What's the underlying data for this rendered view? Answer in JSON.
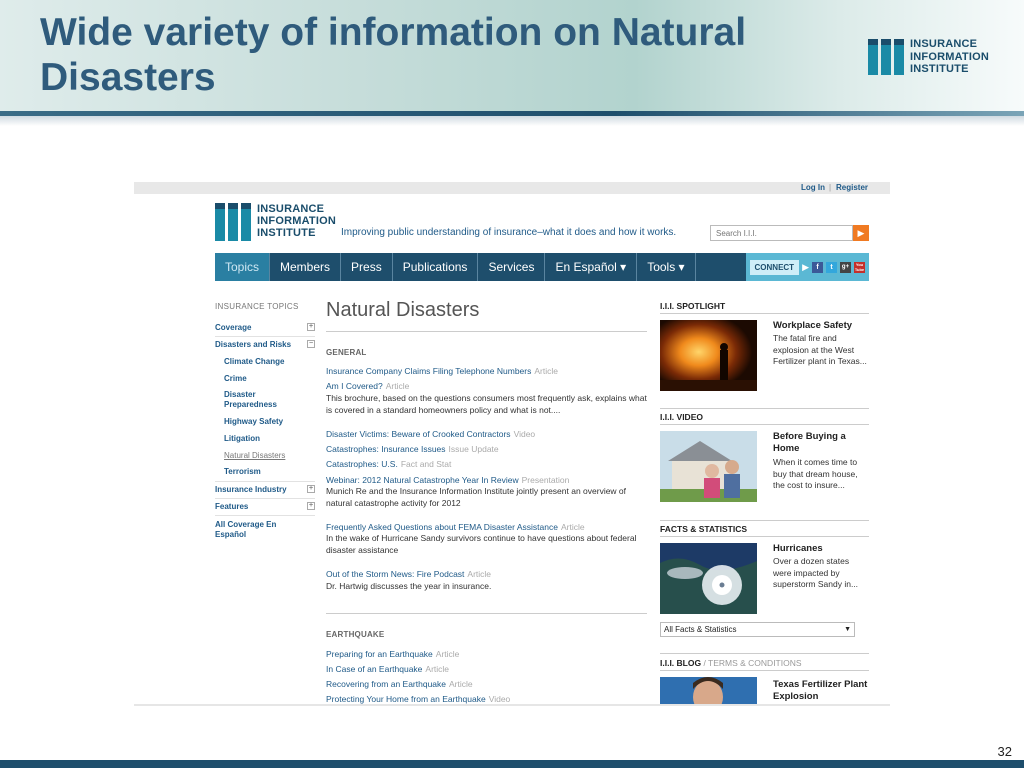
{
  "slide": {
    "title": "Wide variety of information on Natural Disasters",
    "logo_lines": [
      "INSURANCE",
      "INFORMATION",
      "INSTITUTE"
    ],
    "page_number": "32",
    "colors": {
      "title": "#2f5b7c",
      "accent": "#1e4e6c",
      "teal": "#1a8aa6"
    }
  },
  "site": {
    "topbar": {
      "login": "Log In",
      "separator": "|",
      "register": "Register"
    },
    "logo_lines": [
      "INSURANCE",
      "INFORMATION",
      "INSTITUTE"
    ],
    "tagline": "Improving public understanding of insurance–what it does and how it works.",
    "search": {
      "placeholder": "Search I.I.I.",
      "go_icon": "arrow-right-icon"
    },
    "nav": [
      {
        "label": "Topics",
        "active": true
      },
      {
        "label": "Members"
      },
      {
        "label": "Press"
      },
      {
        "label": "Publications"
      },
      {
        "label": "Services"
      },
      {
        "label": "En Español ▾"
      },
      {
        "label": "Tools ▾"
      }
    ],
    "connect": {
      "label": "CONNECT",
      "social": [
        "f",
        "t",
        "g+",
        "You Tube"
      ]
    },
    "sidebar": {
      "title": "INSURANCE TOPICS",
      "coverage": "Coverage",
      "disasters": "Disasters and Risks",
      "sub": [
        "Climate Change",
        "Crime",
        "Disaster Preparedness",
        "Highway Safety",
        "Litigation",
        "Natural Disasters",
        "Terrorism"
      ],
      "industry": "Insurance Industry",
      "features": "Features",
      "espanol": "All Coverage En Español",
      "plus": "+",
      "minus": "−"
    },
    "main": {
      "title": "Natural Disasters",
      "general_head": "GENERAL",
      "general": [
        {
          "title": "Insurance Company Claims Filing Telephone Numbers",
          "type": "Article"
        },
        {
          "title": "Am I Covered?",
          "type": "Article",
          "desc": "This brochure, based on the questions consumers most frequently ask, explains what is covered in a standard homeowners policy and what is not...."
        },
        {
          "title": "Disaster Victims: Beware of Crooked Contractors",
          "type": "Video"
        },
        {
          "title": "Catastrophes: Insurance Issues",
          "type": "Issue Update"
        },
        {
          "title": "Catastrophes: U.S.",
          "type": "Fact and Stat"
        },
        {
          "title": "Webinar: 2012 Natural Catastrophe Year In Review",
          "type": "Presentation",
          "desc": "Munich Re and the Insurance Information Institute jointly present an overview of natural catastrophe activity for 2012"
        },
        {
          "title": "Frequently Asked Questions about FEMA Disaster Assistance",
          "type": "Article",
          "desc": "In the wake of Hurricane Sandy survivors continue to have questions about federal disaster assistance"
        },
        {
          "title": "Out of the Storm News: Fire Podcast",
          "type": "Article",
          "desc": "Dr. Hartwig discusses the year in insurance."
        }
      ],
      "earthquake_head": "EARTHQUAKE",
      "earthquake": [
        {
          "title": "Preparing for an Earthquake",
          "type": "Article"
        },
        {
          "title": "In Case of an Earthquake",
          "type": "Article"
        },
        {
          "title": "Recovering from an Earthquake",
          "type": "Article"
        },
        {
          "title": "Protecting Your Home from an Earthquake",
          "type": "Video"
        }
      ]
    },
    "right": {
      "spotlight": {
        "head": "I.I.I. SPOTLIGHT",
        "title": "Workplace Safety",
        "text": "The fatal fire and explosion at the West Fertilizer plant in Texas..."
      },
      "video": {
        "head": "I.I.I. VIDEO",
        "title": "Before Buying a Home",
        "text": "When it comes time to buy that dream house, the cost to insure..."
      },
      "facts": {
        "head": "FACTS & STATISTICS",
        "title": "Hurricanes",
        "text": "Over a dozen states were impacted by superstorm Sandy in...",
        "select": "All Facts & Statistics"
      },
      "blog": {
        "head": "I.I.I. BLOG",
        "slash": " / ",
        "terms": "TERMS & CONDITIONS",
        "title": "Texas Fertilizer Plant Explosion"
      }
    }
  }
}
